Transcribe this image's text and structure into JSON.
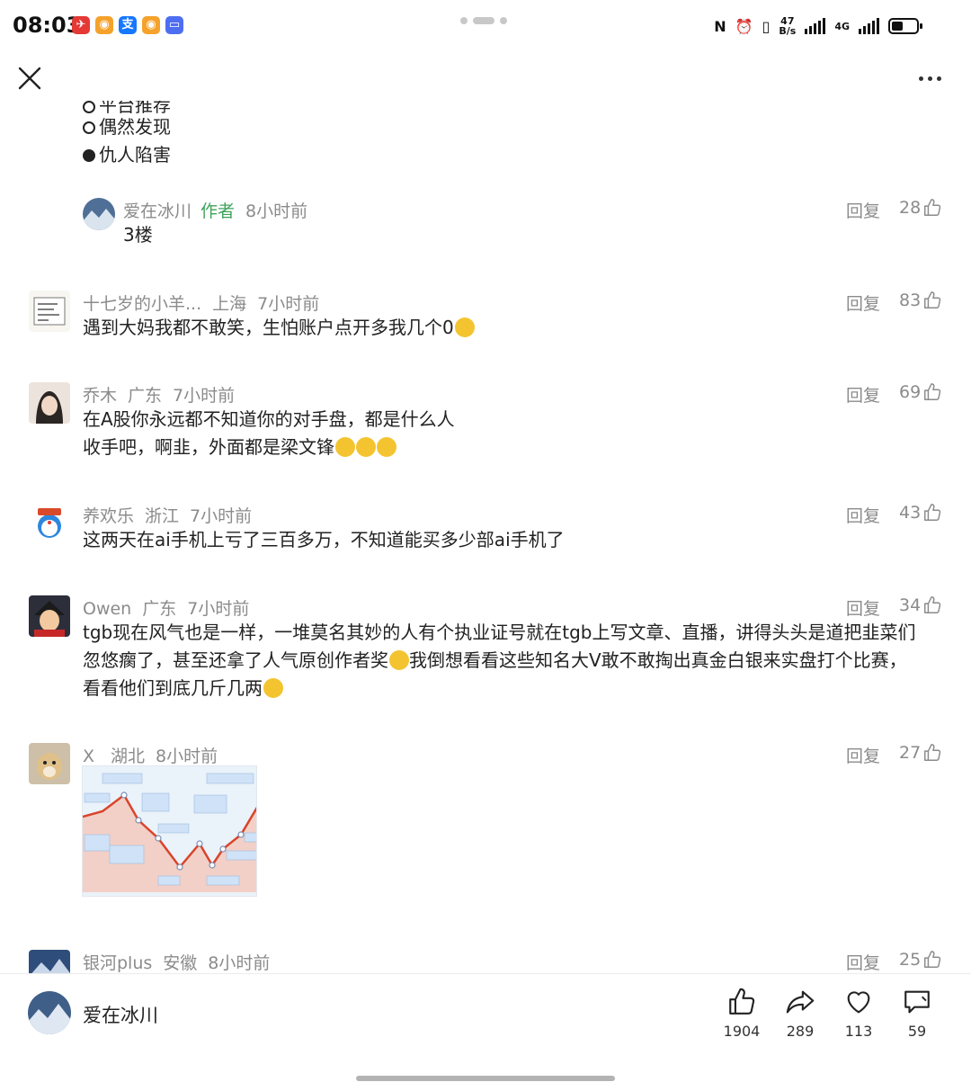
{
  "status_bar": {
    "time": "08:03",
    "net_speed_top": "47",
    "net_speed_bottom": "B/s",
    "network": "4G",
    "apps": [
      {
        "icon": "red-app-icon",
        "color": "#e53935",
        "glyph": "✈"
      },
      {
        "icon": "weibo-icon",
        "color": "#f4a22b",
        "glyph": "◉"
      },
      {
        "icon": "alipay-icon",
        "color": "#1677ff",
        "glyph": "支"
      },
      {
        "icon": "weibo-icon",
        "color": "#f4a22b",
        "glyph": "◉"
      },
      {
        "icon": "message-icon",
        "color": "#4e6ef2",
        "glyph": "▭"
      }
    ],
    "battery_level": 0.45
  },
  "poll": {
    "options": [
      {
        "label": "平台推荐",
        "selected": false
      },
      {
        "label": "偶然发现",
        "selected": false
      },
      {
        "label": "仇人陷害",
        "selected": true
      }
    ]
  },
  "comments": [
    {
      "name": "爱在冰川",
      "tag": "作者",
      "location": "",
      "time": "8小时前",
      "reply": "回复",
      "likes": "28",
      "lines": [
        "3楼"
      ]
    },
    {
      "name": "十七岁的小羊...",
      "tag": "",
      "location": "上海",
      "time": "7小时前",
      "reply": "回复",
      "likes": "83",
      "lines": [
        "遇到大妈我都不敢笑，生怕账户点开多我几个0"
      ]
    },
    {
      "name": "乔木",
      "tag": "",
      "location": "广东",
      "time": "7小时前",
      "reply": "回复",
      "likes": "69",
      "lines": [
        "在A股你永远都不知道你的对手盘，都是什么人",
        "收手吧，啊韭，外面都是梁文锋"
      ]
    },
    {
      "name": "养欢乐",
      "tag": "",
      "location": "浙江",
      "time": "7小时前",
      "reply": "回复",
      "likes": "43",
      "lines": [
        "这两天在ai手机上亏了三百多万，不知道能买多少部ai手机了"
      ]
    },
    {
      "name": "Owen",
      "tag": "",
      "location": "广东",
      "time": "7小时前",
      "reply": "回复",
      "likes": "34",
      "lines": [
        "tgb现在风气也是一样，一堆莫名其妙的人有个执业证号就在tgb上写文章、直播，讲得头头是道把韭菜们",
        "忽悠瘸了，甚至还拿了人气原创作者奖",
        "我倒想看看这些知名大V敢不敢掏出真金白银来实盘打个比赛，",
        "看看他们到底几斤几两"
      ]
    },
    {
      "name": "X",
      "tag": "",
      "location": "湖北",
      "time": "8小时前",
      "reply": "回复",
      "likes": "27",
      "lines": []
    },
    {
      "name": "银河plus",
      "tag": "",
      "location": "安徽",
      "time": "8小时前",
      "reply": "回复",
      "likes": "25",
      "lines": []
    }
  ],
  "bottom_bar": {
    "author": "爱在冰川",
    "like_count": "1904",
    "share_count": "289",
    "favorite_count": "113",
    "comment_count": "59"
  }
}
